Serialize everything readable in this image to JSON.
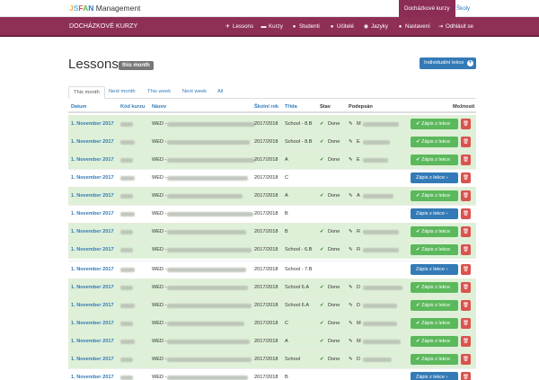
{
  "topbar": {
    "brand_letters": [
      "J",
      "S",
      "F",
      "A",
      "N"
    ],
    "brand_colors": [
      "#f0ad4e",
      "#5bc0de",
      "#d9534f",
      "#5cb85c",
      "#337ab7"
    ],
    "brand_rest": "Management",
    "tabs": [
      {
        "label": "Docházkové kurzy",
        "active": true
      },
      {
        "label": "Školy",
        "active": false
      }
    ]
  },
  "navbar": {
    "title": "DOCHÁZKOVÉ KURZY",
    "items": [
      {
        "label": "Lessons",
        "icon": "paper-plane-icon",
        "glyph": "✈"
      },
      {
        "label": "Kurzy",
        "icon": "car-icon",
        "glyph": "⛟"
      },
      {
        "label": "Studenti",
        "icon": "users-icon",
        "glyph": "👥"
      },
      {
        "label": "Učitelé",
        "icon": "user-icon",
        "glyph": "👤"
      },
      {
        "label": "Jazyky",
        "icon": "globe-icon",
        "glyph": "◉"
      },
      {
        "label": "Nastavení",
        "icon": "user-cog-icon",
        "glyph": "👤"
      },
      {
        "label": "Odhlásit se",
        "icon": "sign-out-icon",
        "glyph": "⇥"
      }
    ],
    "background": "#8e2f56"
  },
  "page": {
    "title": "Lessons",
    "badge": "this month",
    "new_button": "Individuální lekce"
  },
  "tabs": [
    {
      "label": "This month",
      "active": true
    },
    {
      "label": "Next month",
      "active": false
    },
    {
      "label": "This week",
      "active": false
    },
    {
      "label": "Next week",
      "active": false
    },
    {
      "label": "All",
      "active": false
    }
  ],
  "table": {
    "columns": [
      "Datum",
      "Kód kurzu",
      "Název",
      "Školní rok",
      "Třída",
      "Stav",
      "Podepsán",
      "Možnosti"
    ],
    "action_label": "Zápis z lekce",
    "rows": [
      {
        "date": "1. November 2017",
        "name_prefix": "WED -",
        "year": "2017/2018",
        "class": "School - 8.B",
        "status": "Done",
        "signed": "M",
        "done": true
      },
      {
        "date": "1. November 2017",
        "name_prefix": "WED -",
        "year": "2017/2018",
        "class": "School - 8.B",
        "status": "Done",
        "signed": "E",
        "done": true
      },
      {
        "date": "1. November 2017",
        "name_prefix": "WED -",
        "year": "2017/2018",
        "class": "A",
        "status": "Done",
        "signed": "E",
        "done": true
      },
      {
        "date": "1. November 2017",
        "name_prefix": "WED -",
        "year": "2017/2018",
        "class": "C",
        "status": "",
        "signed": "",
        "done": false
      },
      {
        "date": "1. November 2017",
        "name_prefix": "WED -",
        "year": "2017/2018",
        "class": "A",
        "status": "Done",
        "signed": "A",
        "done": true
      },
      {
        "date": "1. November 2017",
        "name_prefix": "WED -",
        "year": "2017/2018",
        "class": "B",
        "status": "",
        "signed": "",
        "done": false
      },
      {
        "date": "1. November 2017",
        "name_prefix": "WED -",
        "year": "2017/2018",
        "class": "B",
        "status": "Done",
        "signed": "R",
        "done": true
      },
      {
        "date": "1. November 2017",
        "name_prefix": "WED -",
        "year": "2017/2018",
        "class": "School - 6.B",
        "status": "Done",
        "signed": "R",
        "done": true
      },
      {
        "date": "1. November 2017",
        "name_prefix": "WED -",
        "year": "2017/2018",
        "class": "School - 7.B",
        "status": "",
        "signed": "",
        "done": false
      },
      {
        "date": "1. November 2017",
        "name_prefix": "WED -",
        "year": "2017/2018",
        "class": "School 6.A",
        "status": "Done",
        "signed": "D",
        "done": true
      },
      {
        "date": "1. November 2017",
        "name_prefix": "WED -",
        "year": "2017/2018",
        "class": "School 6.A",
        "status": "Done",
        "signed": "D",
        "done": true
      },
      {
        "date": "1. November 2017",
        "name_prefix": "WED -",
        "year": "2017/2018",
        "class": "C",
        "status": "Done",
        "signed": "M",
        "done": true
      },
      {
        "date": "1. November 2017",
        "name_prefix": "WED -",
        "year": "2017/2018",
        "class": "A",
        "status": "Done",
        "signed": "M",
        "done": true
      },
      {
        "date": "1. November 2017",
        "name_prefix": "WED -",
        "year": "2017/2018",
        "class": "School",
        "status": "Done",
        "signed": "D",
        "done": true
      },
      {
        "date": "1. November 2017",
        "name_prefix": "WED -",
        "year": "2017/2018",
        "class": "B",
        "status": "",
        "signed": "",
        "done": false
      }
    ]
  }
}
